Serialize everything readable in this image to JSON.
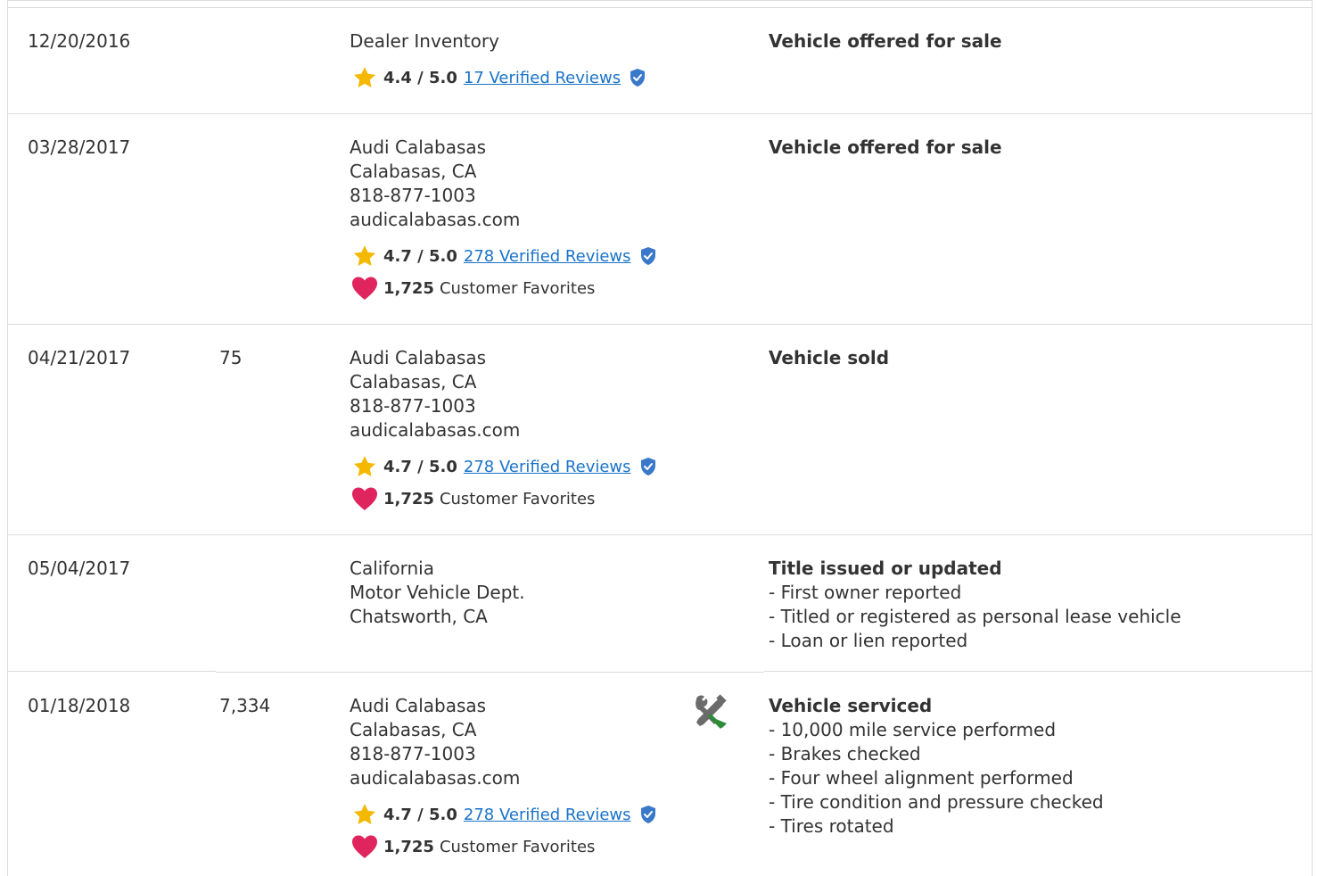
{
  "history": {
    "rows": [
      {
        "date": "12/20/2016",
        "odometer": "",
        "source": {
          "lines": [
            "Dealer Inventory"
          ],
          "rating": "4.4 / 5.0",
          "reviews": "17 Verified Reviews"
        },
        "comments": {
          "title": "Vehicle offered for sale",
          "items": []
        }
      },
      {
        "date": "03/28/2017",
        "odometer": "",
        "source": {
          "lines": [
            "Audi Calabasas",
            "Calabasas, CA",
            "818-877-1003",
            "audicalabasas.com"
          ],
          "rating": "4.7 / 5.0",
          "reviews": "278 Verified Reviews",
          "favorites_count": "1,725",
          "favorites_label": "Customer Favorites"
        },
        "comments": {
          "title": "Vehicle offered for sale",
          "items": []
        }
      },
      {
        "date": "04/21/2017",
        "odometer": "75",
        "source": {
          "lines": [
            "Audi Calabasas",
            "Calabasas, CA",
            "818-877-1003",
            "audicalabasas.com"
          ],
          "rating": "4.7 / 5.0",
          "reviews": "278 Verified Reviews",
          "favorites_count": "1,725",
          "favorites_label": "Customer Favorites"
        },
        "comments": {
          "title": "Vehicle sold",
          "items": []
        }
      },
      {
        "date": "05/04/2017",
        "odometer": "",
        "source": {
          "lines": [
            "California",
            "Motor Vehicle Dept.",
            "Chatsworth, CA"
          ]
        },
        "comments": {
          "title": "Title issued or updated",
          "items": [
            "- First owner reported",
            "- Titled or registered as personal lease vehicle",
            "- Loan or lien reported"
          ]
        }
      },
      {
        "date": "01/18/2018",
        "odometer": "7,334",
        "source": {
          "lines": [
            "Audi Calabasas",
            "Calabasas, CA",
            "818-877-1003",
            "audicalabasas.com"
          ],
          "rating": "4.7 / 5.0",
          "reviews": "278 Verified Reviews",
          "favorites_count": "1,725",
          "favorites_label": "Customer Favorites"
        },
        "icon": "service-tools-icon",
        "comments": {
          "title": "Vehicle serviced",
          "items": [
            "- 10,000 mile service performed",
            "- Brakes checked",
            "- Four wheel alignment performed",
            "- Tire condition and pressure checked",
            "- Tires rotated"
          ]
        }
      }
    ]
  },
  "colors": {
    "link": "#1a73c8",
    "star": "#f5b800",
    "heart": "#e0245e",
    "shield": "#3a78c9",
    "divider": "#dcdcdc",
    "wrench": "#2e8b3a",
    "screwdriver": "#6b6b6b"
  }
}
